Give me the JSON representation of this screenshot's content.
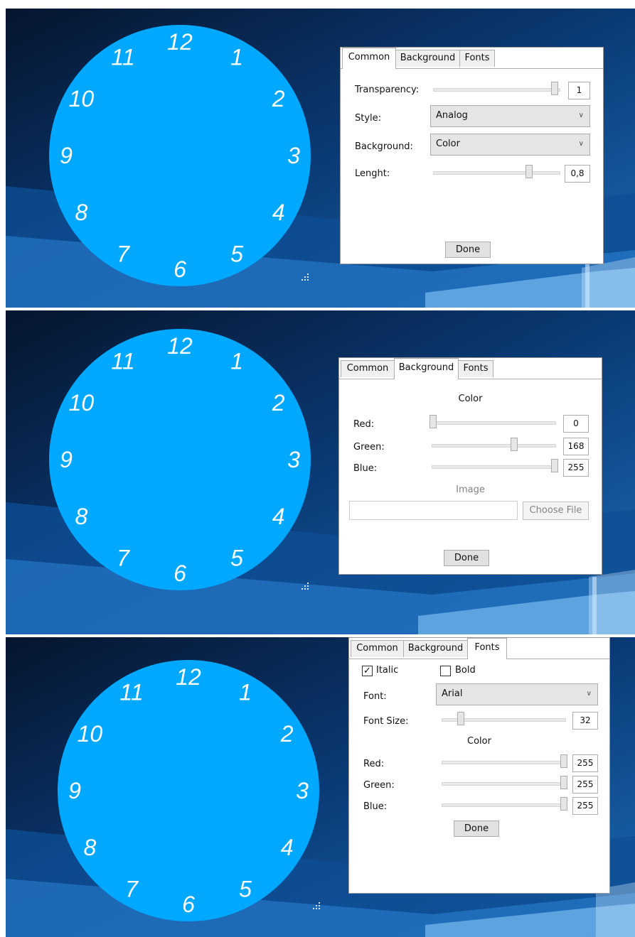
{
  "clock": {
    "numbers": [
      "12",
      "1",
      "2",
      "3",
      "4",
      "5",
      "6",
      "7",
      "8",
      "9",
      "10",
      "11"
    ],
    "face_color": "#00a8ff",
    "number_color": "#ffffff"
  },
  "tabs": [
    "Common",
    "Background",
    "Fonts"
  ],
  "common": {
    "transparency_label": "Transparency:",
    "transparency_value": "1",
    "transparency_level": 1,
    "style_label": "Style:",
    "style_value": "Analog",
    "background_label": "Background:",
    "background_value": "Color",
    "length_label": "Lenght:",
    "length_value": "0,8",
    "length_level": 0.8,
    "done": "Done"
  },
  "background": {
    "color_heading": "Color",
    "red_label": "Red:",
    "red_value": "0",
    "red_level": 0,
    "green_label": "Green:",
    "green_value": "168",
    "green_level": 168,
    "blue_label": "Blue:",
    "blue_value": "255",
    "blue_level": 255,
    "image_heading": "Image",
    "choose_file": "Choose File",
    "done": "Done"
  },
  "fonts": {
    "italic_label": "Italic",
    "italic_checked": true,
    "bold_label": "Bold",
    "bold_checked": false,
    "font_label": "Font:",
    "font_value": "Arial",
    "font_size_label": "Font Size:",
    "font_size_value": "32",
    "color_heading": "Color",
    "red_label": "Red:",
    "red_value": "255",
    "green_label": "Green:",
    "green_value": "255",
    "blue_label": "Blue:",
    "blue_value": "255",
    "done": "Done"
  }
}
